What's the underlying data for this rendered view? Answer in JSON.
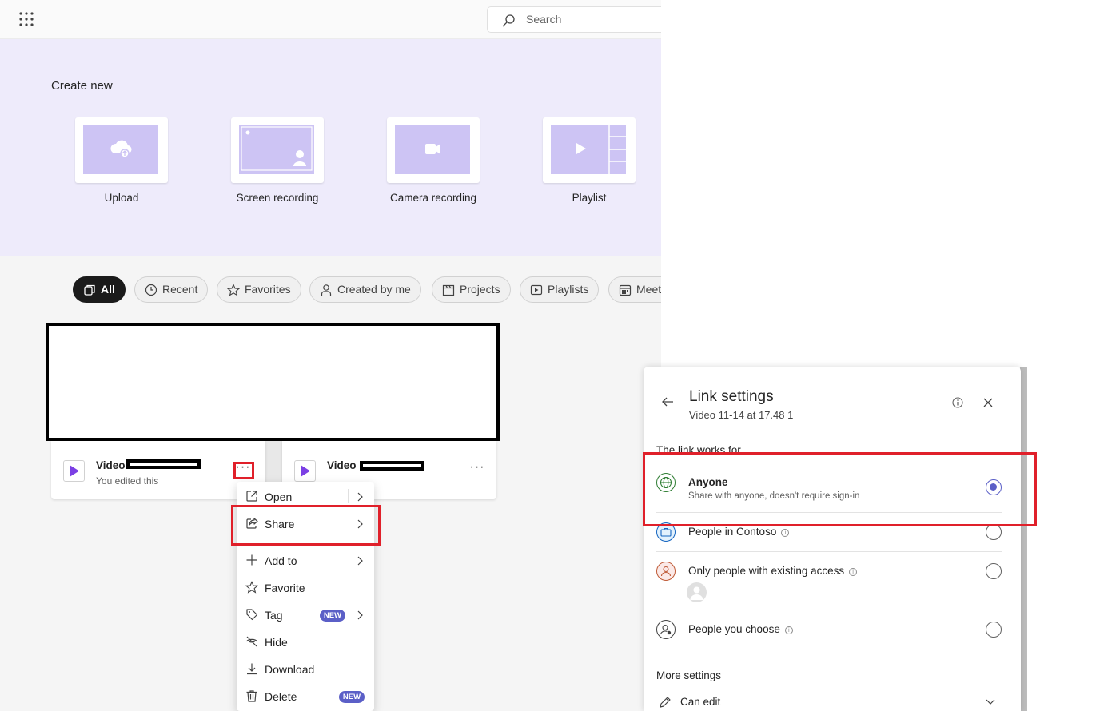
{
  "search": {
    "placeholder": "Search"
  },
  "create_new": {
    "heading": "Create new",
    "tiles": [
      {
        "label": "Upload",
        "icon": "cloud-upload-icon"
      },
      {
        "label": "Screen recording",
        "icon": "screen-recording-icon"
      },
      {
        "label": "Camera recording",
        "icon": "camera-icon"
      },
      {
        "label": "Playlist",
        "icon": "playlist-icon"
      }
    ]
  },
  "filters": [
    {
      "label": "All",
      "icon": "all-icon",
      "active": true
    },
    {
      "label": "Recent",
      "icon": "clock-icon"
    },
    {
      "label": "Favorites",
      "icon": "star-icon"
    },
    {
      "label": "Created by me",
      "icon": "person-icon"
    },
    {
      "label": "Projects",
      "icon": "clapper-icon"
    },
    {
      "label": "Playlists",
      "icon": "playlist-icon"
    },
    {
      "label": "Meet",
      "icon": "calendar-icon"
    }
  ],
  "videos": [
    {
      "name": "Video",
      "subtitle": "You edited this"
    },
    {
      "name": "Video",
      "subtitle": ""
    }
  ],
  "context_menu": {
    "items": [
      {
        "label": "Open",
        "icon": "open-icon",
        "submenu": true
      },
      {
        "label": "Share",
        "icon": "share-icon",
        "submenu": true
      },
      {
        "label": "Add to",
        "icon": "plus-icon",
        "submenu": true
      },
      {
        "label": "Favorite",
        "icon": "star-icon"
      },
      {
        "label": "Tag",
        "icon": "tag-icon",
        "badge": "NEW",
        "submenu": true
      },
      {
        "label": "Hide",
        "icon": "eye-off-icon"
      },
      {
        "label": "Download",
        "icon": "download-icon"
      },
      {
        "label": "Delete",
        "icon": "trash-icon",
        "badge": "NEW"
      }
    ]
  },
  "link_settings": {
    "title": "Link settings",
    "subtitle": "Video 11-14 at 17.48 1",
    "section_label": "The link works for",
    "options": [
      {
        "title": "Anyone",
        "description": "Share with anyone, doesn't require sign-in",
        "icon": "globe-icon",
        "selected": true
      },
      {
        "title": "People in Contoso",
        "icon": "briefcase-icon",
        "selected": false
      },
      {
        "title": "Only people with existing access",
        "icon": "person-icon",
        "selected": false
      },
      {
        "title": "People you choose",
        "icon": "person-settings-icon",
        "selected": false
      }
    ],
    "more_settings_label": "More settings",
    "permission": "Can edit"
  },
  "colors": {
    "accent": "#5b5fc7",
    "hero_bg": "#eeebfb",
    "highlight": "#e0202a",
    "play": "#7b3fe4"
  }
}
